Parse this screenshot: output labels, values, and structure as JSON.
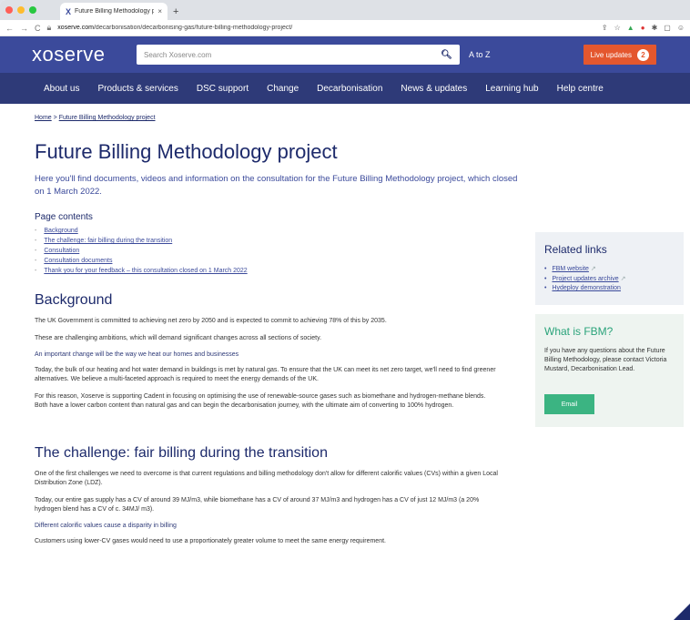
{
  "browser": {
    "tab_title": "Future Billing Methodology pro",
    "tab_close": "×",
    "new_tab": "+",
    "url_domain": "xoserve.com",
    "url_path": "/decarbonisation/decarbonising-gas/future-billing-methodology-project/"
  },
  "header": {
    "logo": "xoserve",
    "search_placeholder": "Search Xoserve.com",
    "atoz": "A to Z",
    "live_updates": "Live updates",
    "live_count": "2"
  },
  "nav": [
    "About us",
    "Products & services",
    "DSC support",
    "Change",
    "Decarbonisation",
    "News & updates",
    "Learning hub",
    "Help centre"
  ],
  "breadcrumb": {
    "home": "Home",
    "sep": ">",
    "current": "Future Billing Methodology project"
  },
  "page": {
    "title": "Future Billing Methodology project",
    "intro": "Here you'll find documents, videos and information on the consultation for the Future Billing Methodology project, which closed on 1 March 2022."
  },
  "page_contents": {
    "title": "Page contents",
    "items": [
      "Background",
      "The challenge: fair billing during the transition",
      "Consultation",
      "Consultation documents",
      "Thank you for your feedback – this consultation closed on 1 March 2022"
    ]
  },
  "background": {
    "title": "Background",
    "p1": "The UK Government is committed to achieving net zero by 2050 and is expected to commit to achieving 78% of this by 2035.",
    "p2": "These are challenging ambitions, which will demand significant changes across all sections of society.",
    "sub": "An important change will be the way we heat our homes and businesses",
    "p3": "Today, the bulk of our heating and hot water demand in buildings is met by natural gas. To ensure that the UK can meet its net zero target, we'll need to find greener alternatives. We believe a multi-faceted approach is required to meet the energy demands of the UK.",
    "p4": "For this reason, Xoserve is supporting Cadent in focusing on optimising the use of renewable-source gases such as biomethane and hydrogen-methane blends. Both have a lower carbon content than natural gas and can begin the decarbonisation journey, with the ultimate aim of converting to 100% hydrogen."
  },
  "challenge": {
    "title": "The challenge: fair billing during the transition",
    "p1": "One of the first challenges we need to overcome is that current regulations and billing methodology don't allow for different calorific values (CVs) within a given Local Distribution Zone (LDZ).",
    "p2": "Today, our entire gas supply has a CV of around 39 MJ/m3, while biomethane has a CV of around 37 MJ/m3 and hydrogen has a CV of just 12 MJ/m3 (a 20% hydrogen blend has a CV of c. 34MJ/ m3).",
    "sub": "Different calorific values cause a disparity in billing",
    "p3": "Customers using lower-CV gases would need to use a proportionately greater volume to meet the same energy requirement."
  },
  "related": {
    "title": "Related links",
    "items": [
      "FBM website",
      "Project updates archive",
      "Hydeploy demonstration"
    ]
  },
  "fbm": {
    "title": "What is FBM?",
    "text": "If you have any questions about the Future Billing Methodology, please contact Victoria Mustard, Decarbonisation Lead.",
    "button": "Email"
  },
  "colors": {
    "brand": "#3b4a9b",
    "nav": "#2e3a78",
    "live": "#e4572e",
    "green": "#3bb482"
  }
}
